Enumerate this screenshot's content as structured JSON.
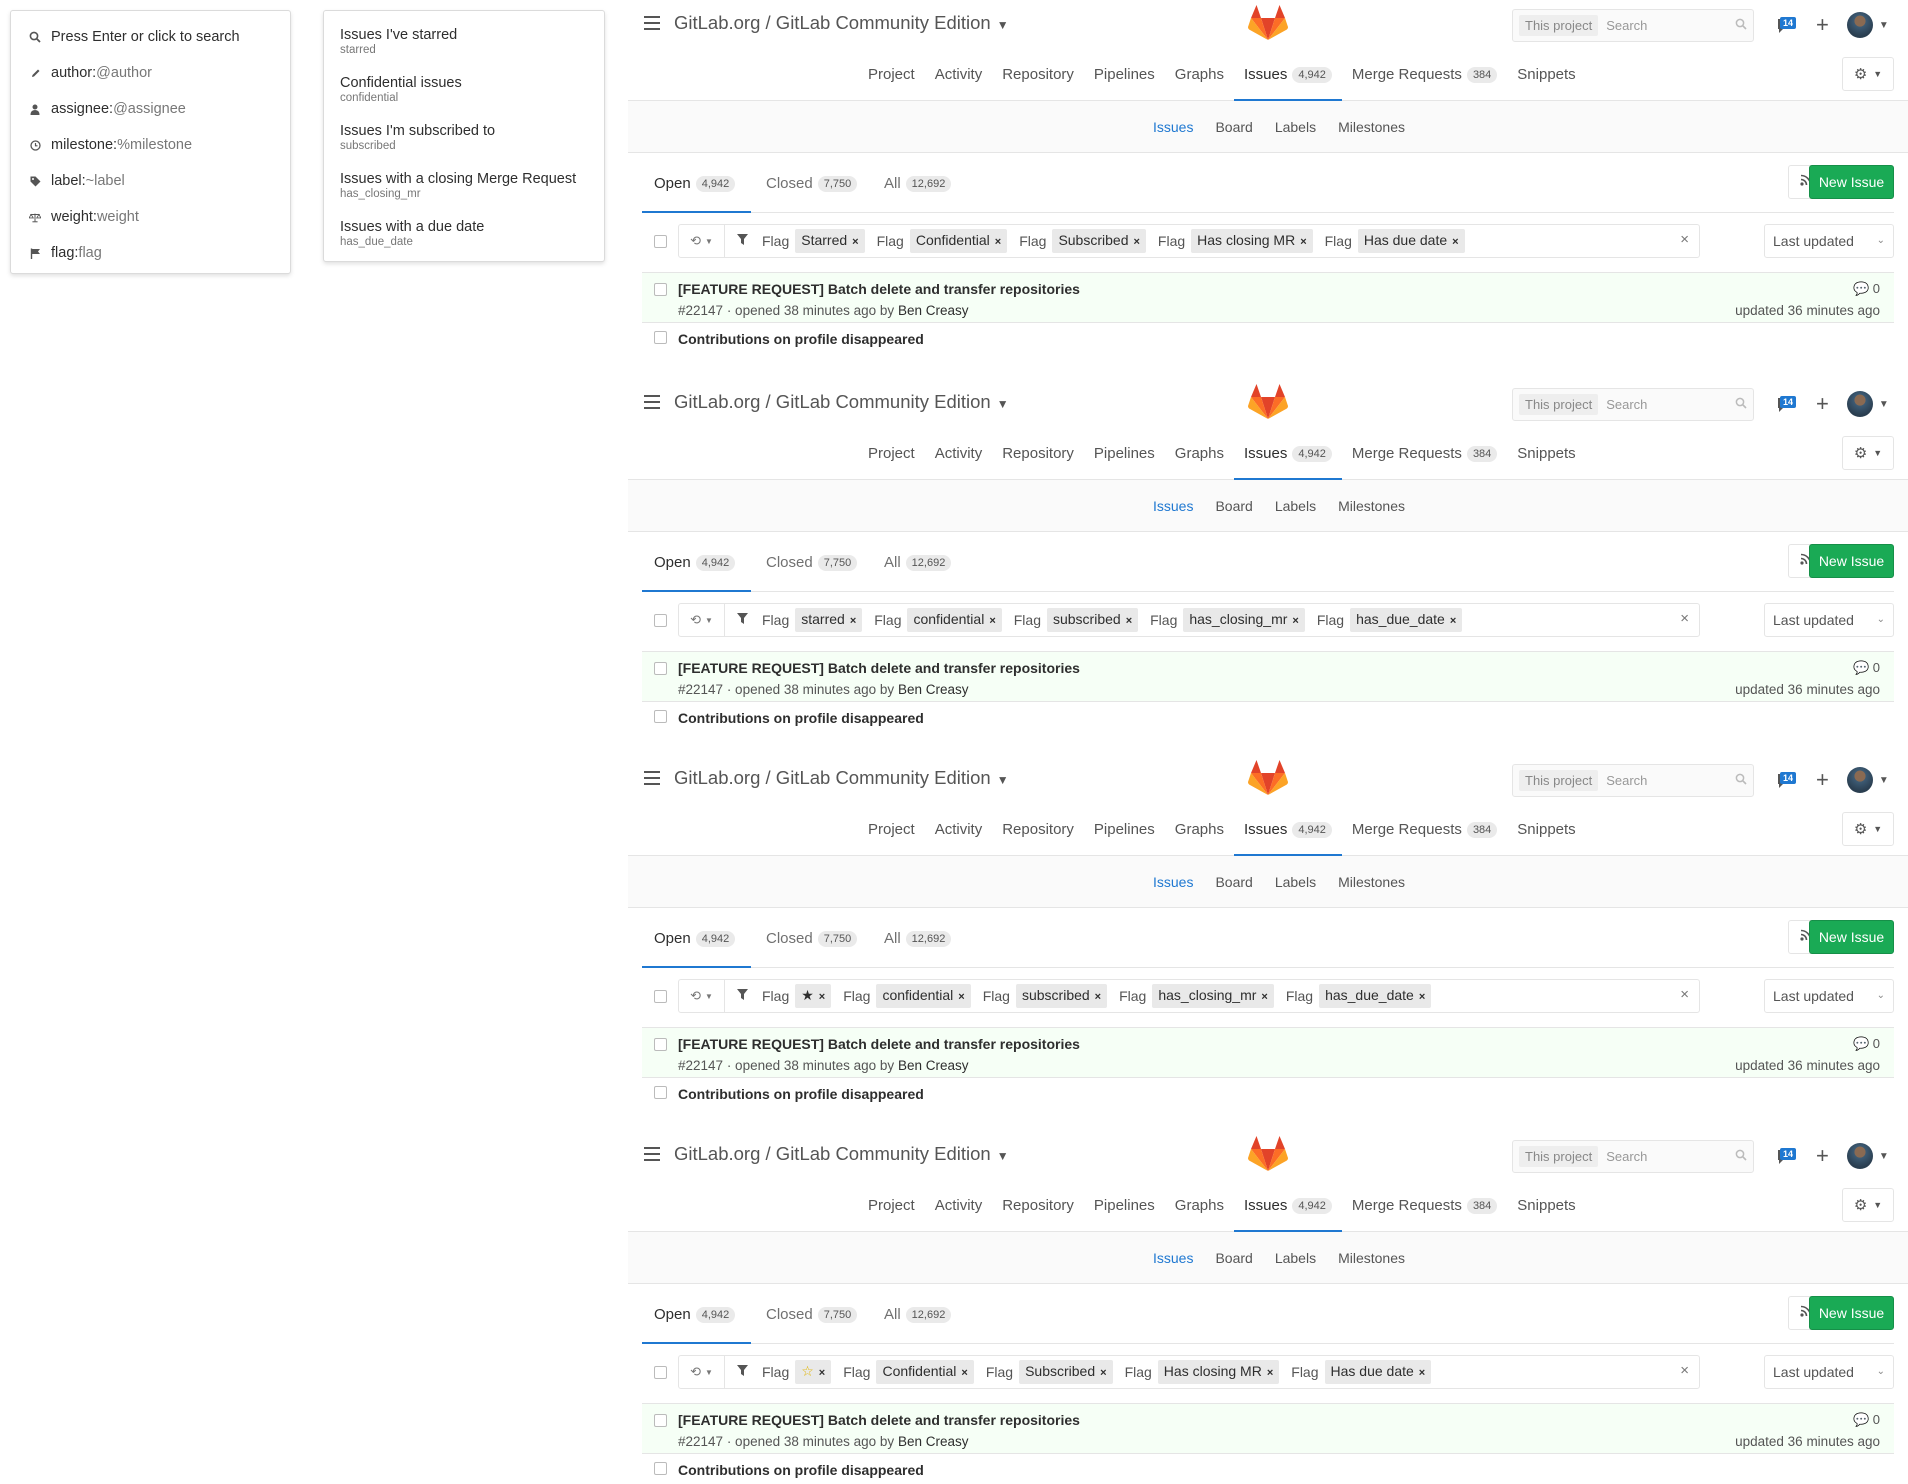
{
  "search_dropdown": {
    "items": [
      {
        "icon": "search-icon",
        "label": "Press Enter or click to search",
        "hint": ""
      },
      {
        "icon": "pencil-icon",
        "label": "author:",
        "hint": "@author"
      },
      {
        "icon": "user-icon",
        "label": "assignee:",
        "hint": "@assignee"
      },
      {
        "icon": "clock-icon",
        "label": "milestone:",
        "hint": "%milestone"
      },
      {
        "icon": "tag-icon",
        "label": "label:",
        "hint": "~label"
      },
      {
        "icon": "balance-scale-icon",
        "label": "weight:",
        "hint": "weight"
      },
      {
        "icon": "flag-icon",
        "label": "flag:",
        "hint": "flag"
      }
    ]
  },
  "flag_dropdown": {
    "items": [
      {
        "title": "Issues I've starred",
        "value": "starred"
      },
      {
        "title": "Confidential issues",
        "value": "confidential"
      },
      {
        "title": "Issues I'm subscribed to",
        "value": "subscribed"
      },
      {
        "title": "Issues with a closing Merge Request",
        "value": "has_closing_mr"
      },
      {
        "title": "Issues with a due date",
        "value": "has_due_date"
      }
    ]
  },
  "header": {
    "title": "GitLab.org / GitLab Community Edition",
    "search_scope": "This project",
    "search_placeholder": "Search",
    "notifications": "14"
  },
  "nav": [
    {
      "label": "Project",
      "count": ""
    },
    {
      "label": "Activity",
      "count": ""
    },
    {
      "label": "Repository",
      "count": ""
    },
    {
      "label": "Pipelines",
      "count": ""
    },
    {
      "label": "Graphs",
      "count": ""
    },
    {
      "label": "Issues",
      "count": "4,942"
    },
    {
      "label": "Merge Requests",
      "count": "384"
    },
    {
      "label": "Snippets",
      "count": ""
    }
  ],
  "subnav": [
    "Issues",
    "Board",
    "Labels",
    "Milestones"
  ],
  "state_tabs": [
    {
      "label": "Open",
      "count": "4,942"
    },
    {
      "label": "Closed",
      "count": "7,750"
    },
    {
      "label": "All",
      "count": "12,692"
    }
  ],
  "new_issue_label": "New Issue",
  "sort_label": "Last updated",
  "token_key": "Flag",
  "frames": [
    {
      "tokens": [
        "Starred",
        "Confidential",
        "Subscribed",
        "Has closing MR",
        "Has due date"
      ]
    },
    {
      "tokens": [
        "starred",
        "confidential",
        "subscribed",
        "has_closing_mr",
        "has_due_date"
      ]
    },
    {
      "tokens": [
        "★",
        "confidential",
        "subscribed",
        "has_closing_mr",
        "has_due_date"
      ]
    },
    {
      "tokens": [
        "☆",
        "Confidential",
        "Subscribed",
        "Has closing MR",
        "Has due date"
      ]
    }
  ],
  "issue": {
    "title": "[FEATURE REQUEST] Batch delete and transfer repositories",
    "number": "#22147",
    "opened": " · opened 38 minutes ago by ",
    "author": "Ben Creasy",
    "comments": "0",
    "updated": "updated 36 minutes ago"
  },
  "issue_next_title": "Contributions on profile disappeared"
}
